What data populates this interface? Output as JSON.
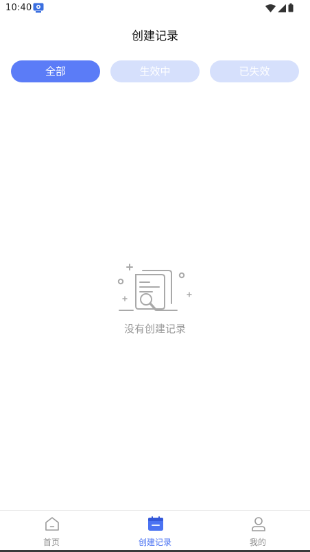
{
  "status_bar": {
    "time": "10:40",
    "icons": [
      "app-notification-icon",
      "wifi-icon",
      "cellular-signal-icon",
      "battery-icon"
    ]
  },
  "header": {
    "title": "创建记录"
  },
  "tabs": [
    {
      "label": "全部",
      "active": true
    },
    {
      "label": "生效中",
      "active": false
    },
    {
      "label": "已失效",
      "active": false
    }
  ],
  "empty_state": {
    "icon": "empty-document-search-icon",
    "text": "没有创建记录"
  },
  "bottom_nav": {
    "items": [
      {
        "label": "首页",
        "icon": "home-icon",
        "active": false
      },
      {
        "label": "创建记录",
        "icon": "calendar-icon",
        "active": true
      },
      {
        "label": "我的",
        "icon": "profile-icon",
        "active": false
      }
    ]
  },
  "colors": {
    "accent": "#5b7cf7",
    "tab_inactive": "#d6e0fc",
    "nav_active": "#4b73f2",
    "nav_inactive": "#8c8c8c",
    "empty_text": "#9a9a9a"
  }
}
